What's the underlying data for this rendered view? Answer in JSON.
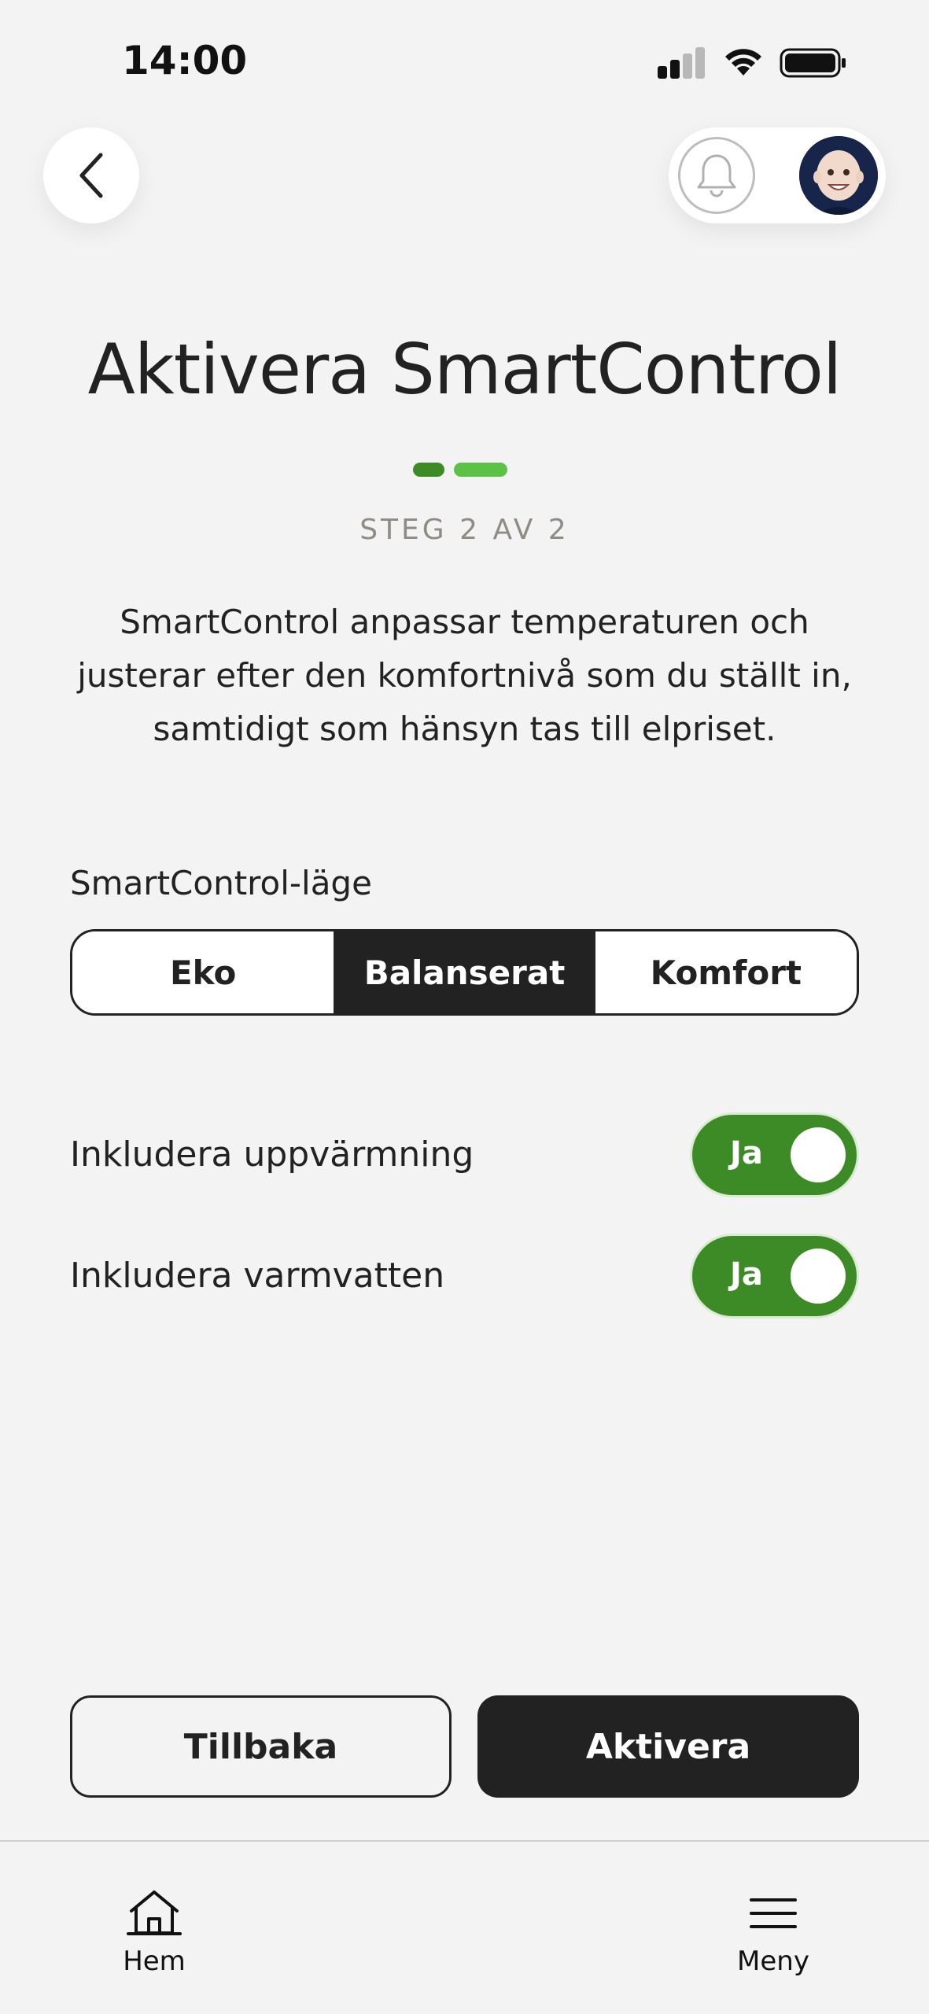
{
  "status_bar": {
    "time": "14:00"
  },
  "header": {
    "back_icon": "chevron-left-icon",
    "bell_icon": "bell-icon",
    "avatar_icon": "memoji-avatar"
  },
  "page": {
    "title": "Aktivera SmartControl",
    "step_text": "STEG 2 AV 2",
    "step_dot_colors": [
      "#3d8b26",
      "#5cc246"
    ],
    "description": "SmartControl anpassar temperaturen och justerar efter den komfortnivå som du ställt in, samtidigt som hänsyn tas till elpriset."
  },
  "mode": {
    "label": "SmartControl-läge",
    "options": [
      "Eko",
      "Balanserat",
      "Komfort"
    ],
    "selected": "Balanserat"
  },
  "toggles": [
    {
      "label": "Inkludera uppvärmning",
      "value": "Ja",
      "on": true
    },
    {
      "label": "Inkludera varmvatten",
      "value": "Ja",
      "on": true
    }
  ],
  "buttons": {
    "back_label": "Tillbaka",
    "activate_label": "Aktivera"
  },
  "bottom_nav": {
    "home_label": "Hem",
    "home_icon": "home-icon",
    "menu_label": "Meny",
    "menu_icon": "hamburger-menu-icon"
  },
  "colors": {
    "accent_green": "#3d8b26",
    "dark": "#222222",
    "background": "#f3f3f3"
  }
}
